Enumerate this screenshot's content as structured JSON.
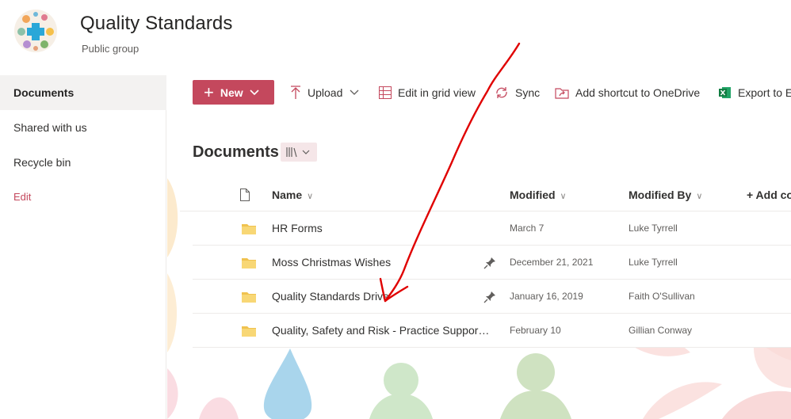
{
  "site": {
    "title": "Quality Standards",
    "subtitle": "Public group"
  },
  "nav": {
    "items": [
      {
        "label": "Documents",
        "active": true
      },
      {
        "label": "Shared with us",
        "active": false
      },
      {
        "label": "Recycle bin",
        "active": false
      }
    ],
    "edit_label": "Edit"
  },
  "toolbar": {
    "new_label": "New",
    "upload_label": "Upload",
    "grid_label": "Edit in grid view",
    "sync_label": "Sync",
    "shortcut_label": "Add shortcut to OneDrive",
    "export_label": "Export to E"
  },
  "library": {
    "title": "Documents",
    "columns": {
      "name": "Name",
      "modified": "Modified",
      "modified_by": "Modified By",
      "add_column": "+ Add co"
    },
    "rows": [
      {
        "name": "HR Forms",
        "modified": "March 7",
        "modified_by": "Luke Tyrrell",
        "pinned": false
      },
      {
        "name": "Moss Christmas Wishes",
        "modified": "December 21, 2021",
        "modified_by": "Luke Tyrrell",
        "pinned": true
      },
      {
        "name": "Quality Standards Drive",
        "modified": "January 16, 2019",
        "modified_by": "Faith O'Sullivan",
        "pinned": true
      },
      {
        "name": "Quality, Safety and Risk - Practice Support ...",
        "modified": "February 10",
        "modified_by": "Gillian Conway",
        "pinned": false
      }
    ]
  },
  "colors": {
    "accent": "#c4485d",
    "folder": "#f8d775",
    "annotation": "#e00000"
  }
}
